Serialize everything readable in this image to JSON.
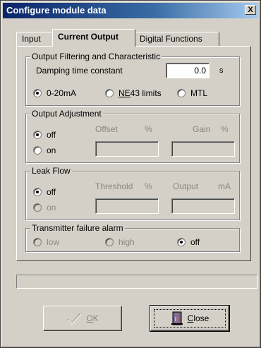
{
  "window": {
    "title": "Configure module data",
    "close_glyph": "X"
  },
  "tabs": [
    {
      "label": "Input",
      "active": false
    },
    {
      "label": "Current Output",
      "active": true
    },
    {
      "label": "Digital Functions",
      "active": false
    }
  ],
  "output_filtering": {
    "legend": "Output Filtering and Characteristic",
    "damping_label": "Damping time constant",
    "damping_value": "0.0",
    "damping_unit": "s",
    "options": [
      {
        "label": "0-20mA",
        "checked": true
      },
      {
        "label_prefix": "NE",
        "label_rest": "43 limits",
        "checked": false
      },
      {
        "label": "MTL",
        "checked": false
      }
    ]
  },
  "output_adjustment": {
    "legend": "Output Adjustment",
    "off_label": "off",
    "on_label": "on",
    "offset_label": "Offset",
    "offset_unit": "%",
    "gain_label": "Gain",
    "gain_unit": "%",
    "offset_value": "",
    "gain_value": ""
  },
  "leak_flow": {
    "legend": "Leak Flow",
    "off_label": "off",
    "on_label": "on",
    "threshold_label": "Threshold",
    "threshold_unit": "%",
    "output_label": "Output",
    "output_unit": "mA",
    "threshold_value": "",
    "output_value": ""
  },
  "failure_alarm": {
    "legend": "Transmitter failure alarm",
    "low_label": "low",
    "high_label": "high",
    "off_label": "off"
  },
  "status_text": "",
  "buttons": {
    "ok_label_first": "O",
    "ok_label_rest": "K",
    "close_label_first": "C",
    "close_label_rest": "lose"
  },
  "icons": {
    "ok": "check-icon",
    "close": "close-door-icon"
  },
  "colors": {
    "title_start": "#0a246a",
    "title_end": "#a6caf0",
    "face": "#d4d0c8",
    "disabled_text": "#8a8680"
  }
}
